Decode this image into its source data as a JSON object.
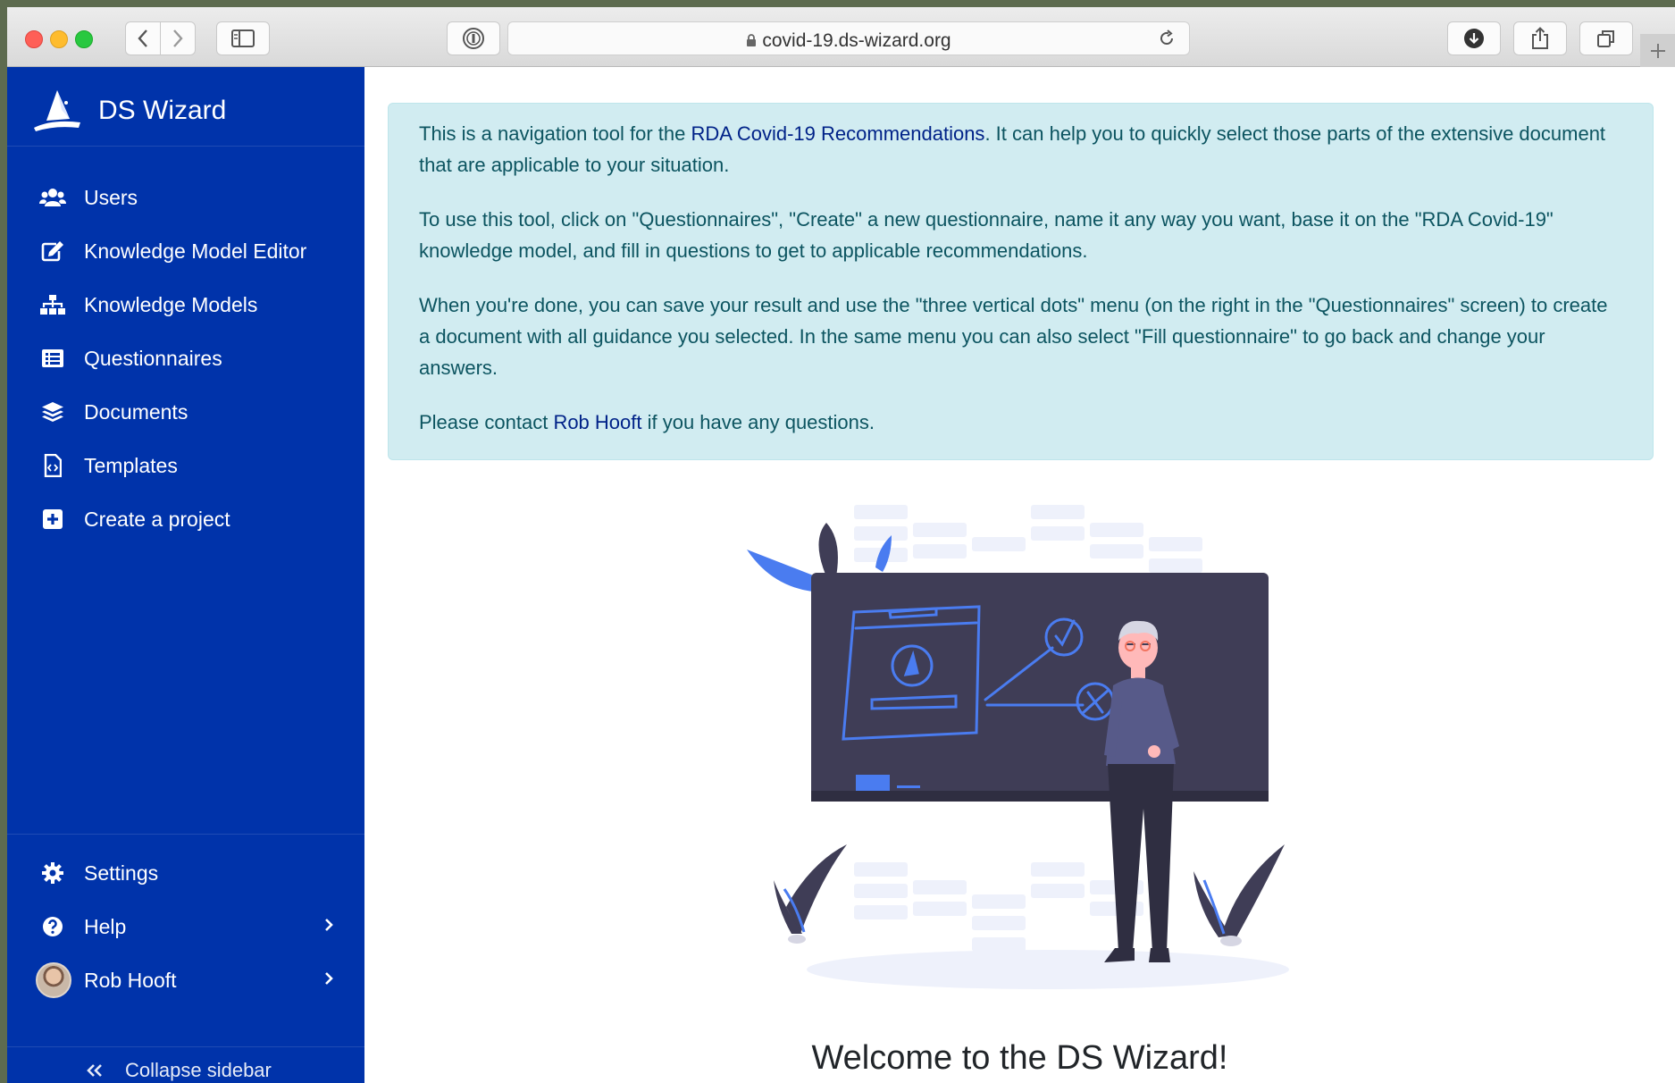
{
  "browser": {
    "url": "covid-19.ds-wizard.org",
    "traffic_lights": {
      "close": "#fe5f57",
      "minimize": "#febc2e",
      "zoom": "#28c840"
    }
  },
  "sidebar": {
    "app_name": "DS Wizard",
    "background": "#0033aa",
    "items": [
      {
        "label": "Users",
        "icon": "users-icon"
      },
      {
        "label": "Knowledge Model Editor",
        "icon": "edit-icon"
      },
      {
        "label": "Knowledge Models",
        "icon": "sitemap-icon"
      },
      {
        "label": "Questionnaires",
        "icon": "list-icon"
      },
      {
        "label": "Documents",
        "icon": "layers-icon"
      },
      {
        "label": "Templates",
        "icon": "file-code-icon"
      },
      {
        "label": "Create a project",
        "icon": "plus-square-icon"
      }
    ],
    "bottom": {
      "settings": "Settings",
      "help": "Help",
      "user": "Rob Hooft"
    },
    "collapse": "Collapse sidebar"
  },
  "alert": {
    "p1_pre": "This is a navigation tool for the ",
    "p1_link": "RDA Covid-19 Recommendations",
    "p1_post": ". It can help you to quickly select those parts of the extensive document that are applicable to your situation.",
    "p2": "To use this tool, click on \"Questionnaires\", \"Create\" a new questionnaire, name it any way you want, base it on the \"RDA Covid-19\" knowledge model, and fill in questions to get to applicable recommendations.",
    "p3": "When you're done, you can save your result and use the \"three vertical dots\" menu (on the right in the \"Questionnaires\" screen) to create a document with all guidance you selected. In the same menu you can also select \"Fill questionnaire\" to go back and change your answers.",
    "p4_pre": "Please contact ",
    "p4_link": "Rob Hooft",
    "p4_post": " if you have any questions."
  },
  "welcome": "Welcome to the DS Wizard!"
}
